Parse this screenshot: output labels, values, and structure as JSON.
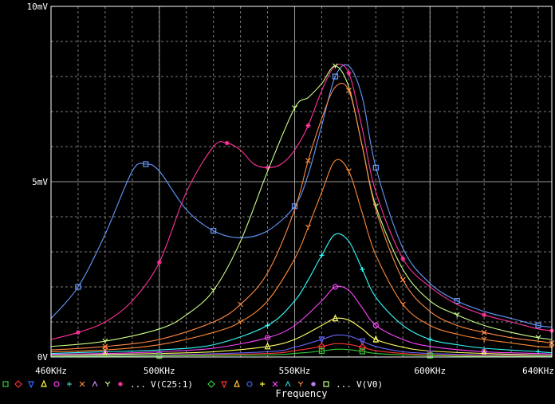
{
  "chart_data": {
    "type": "line",
    "xlabel": "Frequency",
    "ylabel": "",
    "xlim": [
      460,
      645
    ],
    "ylim": [
      0,
      10
    ],
    "grid": true,
    "x_ticks": [
      {
        "value": 460,
        "label": "460KHz"
      },
      {
        "value": 500,
        "label": "500KHz"
      },
      {
        "value": 550,
        "label": "550KHz"
      },
      {
        "value": 600,
        "label": "600KHz"
      },
      {
        "value": 640,
        "label": "640KHz"
      }
    ],
    "y_ticks": [
      {
        "value": 0,
        "label": "0V"
      },
      {
        "value": 5,
        "label": "5mV"
      },
      {
        "value": 10,
        "label": "10mV"
      }
    ],
    "legend": {
      "group1_markers": [
        {
          "marker": "square",
          "color": "#33cc33"
        },
        {
          "marker": "diamond",
          "color": "#ff3333"
        },
        {
          "marker": "triangle-down",
          "color": "#3366ff"
        },
        {
          "marker": "triangle-up",
          "color": "#ffff33"
        },
        {
          "marker": "circle",
          "color": "#ff44ff"
        },
        {
          "marker": "plus",
          "color": "#33cccc"
        },
        {
          "marker": "x",
          "color": "#ff8844"
        },
        {
          "marker": "lambda",
          "color": "#cc88ff"
        },
        {
          "marker": "y",
          "color": "#ccff88"
        },
        {
          "marker": "star",
          "color": "#ff3399"
        }
      ],
      "group1_ellipsis": "...",
      "group1_label": "V(C25:1)",
      "group2_markers": [
        {
          "marker": "diamond",
          "color": "#33cc33"
        },
        {
          "marker": "triangle-down",
          "color": "#ff3333"
        },
        {
          "marker": "triangle-up",
          "color": "#ffcc33"
        },
        {
          "marker": "circle",
          "color": "#3366ff"
        },
        {
          "marker": "plus",
          "color": "#ffff33"
        },
        {
          "marker": "x",
          "color": "#ff44ff"
        },
        {
          "marker": "lambda",
          "color": "#33cccc"
        },
        {
          "marker": "y",
          "color": "#ff8844"
        },
        {
          "marker": "star",
          "color": "#cc88ff"
        },
        {
          "marker": "square",
          "color": "#ccff88"
        }
      ],
      "group2_ellipsis": "...",
      "group2_label": "V(V0)"
    },
    "series": [
      {
        "color": "#6699ff",
        "marker": "square",
        "x": [
          460,
          470,
          480,
          490,
          495,
          500,
          510,
          520,
          530,
          540,
          550,
          555,
          560,
          565,
          570,
          575,
          580,
          590,
          600,
          610,
          620,
          630,
          640,
          645
        ],
        "values": [
          1.1,
          2.0,
          3.5,
          5.3,
          5.5,
          5.3,
          4.2,
          3.6,
          3.4,
          3.6,
          4.3,
          5.2,
          6.6,
          8.0,
          8.3,
          7.4,
          5.4,
          3.1,
          2.1,
          1.6,
          1.3,
          1.1,
          0.9,
          0.85
        ]
      },
      {
        "color": "#ff3399",
        "marker": "star",
        "x": [
          460,
          470,
          480,
          490,
          500,
          510,
          520,
          525,
          530,
          535,
          540,
          545,
          550,
          555,
          560,
          565,
          570,
          575,
          580,
          590,
          600,
          610,
          620,
          630,
          640,
          645
        ],
        "values": [
          0.5,
          0.7,
          1.0,
          1.6,
          2.7,
          4.7,
          6.0,
          6.1,
          5.9,
          5.5,
          5.4,
          5.5,
          5.9,
          6.6,
          7.6,
          8.3,
          8.1,
          6.5,
          4.7,
          2.8,
          2.0,
          1.5,
          1.2,
          1.0,
          0.8,
          0.75
        ]
      },
      {
        "color": "#ccff88",
        "marker": "y",
        "x": [
          460,
          480,
          500,
          510,
          520,
          530,
          540,
          550,
          555,
          560,
          565,
          570,
          575,
          580,
          590,
          600,
          610,
          620,
          630,
          640,
          645
        ],
        "values": [
          0.3,
          0.45,
          0.8,
          1.2,
          1.9,
          3.3,
          5.3,
          7.1,
          7.4,
          7.8,
          8.3,
          7.7,
          6.0,
          4.3,
          2.5,
          1.6,
          1.2,
          0.9,
          0.7,
          0.55,
          0.5
        ]
      },
      {
        "color": "#ff8844",
        "marker": "x",
        "x": [
          460,
          480,
          500,
          520,
          530,
          540,
          550,
          555,
          560,
          565,
          570,
          575,
          580,
          590,
          600,
          610,
          620,
          630,
          640,
          645
        ],
        "values": [
          0.2,
          0.3,
          0.5,
          1.0,
          1.5,
          2.4,
          4.2,
          5.6,
          6.8,
          7.7,
          7.6,
          6.0,
          4.2,
          2.2,
          1.3,
          0.9,
          0.7,
          0.55,
          0.45,
          0.4
        ]
      },
      {
        "color": "#ff8833",
        "marker": "y",
        "x": [
          460,
          480,
          500,
          520,
          530,
          540,
          550,
          555,
          560,
          565,
          570,
          575,
          580,
          590,
          600,
          610,
          620,
          630,
          640,
          645
        ],
        "values": [
          0.15,
          0.2,
          0.35,
          0.7,
          1.0,
          1.6,
          2.8,
          3.7,
          4.7,
          5.6,
          5.3,
          4.1,
          2.9,
          1.5,
          0.9,
          0.65,
          0.5,
          0.4,
          0.3,
          0.28
        ]
      },
      {
        "color": "#33ffff",
        "marker": "plus",
        "x": [
          460,
          480,
          500,
          520,
          540,
          550,
          555,
          560,
          565,
          570,
          575,
          580,
          590,
          600,
          610,
          620,
          640,
          645
        ],
        "values": [
          0.1,
          0.15,
          0.2,
          0.35,
          0.9,
          1.6,
          2.2,
          2.9,
          3.5,
          3.3,
          2.5,
          1.7,
          0.9,
          0.5,
          0.35,
          0.25,
          0.15,
          0.12
        ]
      },
      {
        "color": "#ff44ff",
        "marker": "circle",
        "x": [
          460,
          480,
          500,
          520,
          540,
          550,
          560,
          565,
          570,
          575,
          580,
          590,
          600,
          620,
          640,
          645
        ],
        "values": [
          0.08,
          0.1,
          0.15,
          0.25,
          0.55,
          0.9,
          1.6,
          2.0,
          1.9,
          1.4,
          0.9,
          0.5,
          0.3,
          0.15,
          0.1,
          0.08
        ]
      },
      {
        "color": "#ffff66",
        "marker": "triangle-up",
        "x": [
          460,
          480,
          500,
          520,
          540,
          550,
          560,
          565,
          570,
          575,
          580,
          590,
          600,
          620,
          640,
          645
        ],
        "values": [
          0.05,
          0.07,
          0.1,
          0.15,
          0.3,
          0.5,
          0.9,
          1.1,
          1.05,
          0.8,
          0.5,
          0.28,
          0.17,
          0.1,
          0.06,
          0.05
        ]
      },
      {
        "color": "#6666ff",
        "marker": "triangle-down",
        "x": [
          460,
          500,
          540,
          550,
          560,
          565,
          570,
          575,
          580,
          590,
          600,
          620,
          645
        ],
        "values": [
          0.04,
          0.06,
          0.15,
          0.28,
          0.5,
          0.62,
          0.6,
          0.45,
          0.3,
          0.15,
          0.1,
          0.06,
          0.04
        ]
      },
      {
        "color": "#ff3333",
        "marker": "diamond",
        "x": [
          460,
          500,
          540,
          550,
          560,
          565,
          570,
          575,
          580,
          590,
          600,
          620,
          645
        ],
        "values": [
          0.03,
          0.04,
          0.1,
          0.18,
          0.3,
          0.38,
          0.36,
          0.28,
          0.18,
          0.1,
          0.06,
          0.04,
          0.03
        ]
      },
      {
        "color": "#33cc33",
        "marker": "square",
        "x": [
          460,
          500,
          540,
          550,
          560,
          565,
          570,
          575,
          580,
          590,
          600,
          620,
          645
        ],
        "values": [
          0.02,
          0.03,
          0.06,
          0.1,
          0.17,
          0.22,
          0.21,
          0.16,
          0.1,
          0.06,
          0.04,
          0.02,
          0.02
        ]
      }
    ]
  }
}
